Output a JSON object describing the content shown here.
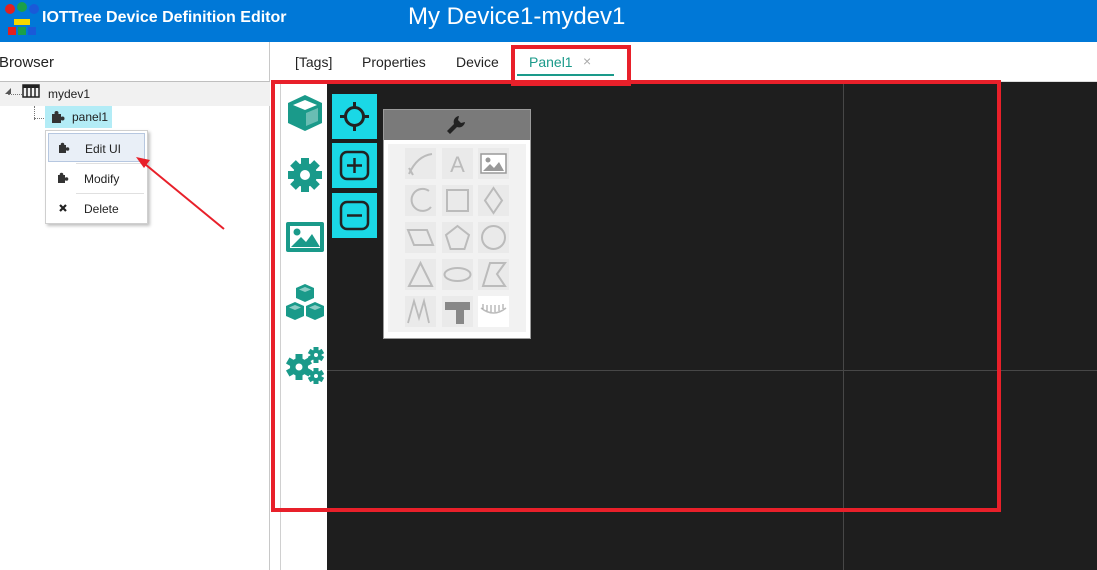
{
  "header": {
    "app_title": "IOTTree Device Definition Editor",
    "doc_title": "My Device1-mydev1",
    "bg_color": "#0078d7"
  },
  "browser": {
    "title": "Browser",
    "tree": {
      "root_label": "mydev1",
      "root_icon": "device-icon",
      "child_label": "panel1",
      "child_icon": "puzzle-icon"
    },
    "context_menu": [
      {
        "label": "Edit UI",
        "icon": "puzzle-icon",
        "highlighted": true
      },
      {
        "label": "Modify",
        "icon": "puzzle-icon",
        "highlighted": false
      },
      {
        "label": "Delete",
        "icon": "x-icon",
        "highlighted": false
      }
    ]
  },
  "tabs": [
    {
      "label": "[Tags]",
      "active": false
    },
    {
      "label": "Properties",
      "active": false
    },
    {
      "label": "Device",
      "active": false
    },
    {
      "label": "Panel1",
      "active": true,
      "closable": true
    }
  ],
  "tab_close_glyph": "×",
  "side_toolbar": [
    "cube-icon",
    "gear-icon",
    "image-icon",
    "cubes-icon",
    "gears-icon"
  ],
  "canvas_tools": [
    "crosshair-icon",
    "zoom-in-icon",
    "zoom-out-icon"
  ],
  "palette": {
    "header_icon": "wrench-icon",
    "tools": [
      "curve-icon",
      "text-icon",
      "image-icon",
      "arc-icon",
      "rectangle-icon",
      "diamond-icon",
      "parallelogram-icon",
      "pentagon-icon",
      "circle-icon",
      "triangle-icon",
      "ellipse-icon",
      "trapezoid-icon",
      "zigzag-icon",
      "pipe-icon",
      "ruler-icon"
    ],
    "text_tool_glyph": "A"
  },
  "colors": {
    "accent_cyan": "#1ad8e6",
    "teal": "#1a9a8a",
    "annotation_red": "#e8202a",
    "canvas_bg": "#1e1e1e"
  }
}
